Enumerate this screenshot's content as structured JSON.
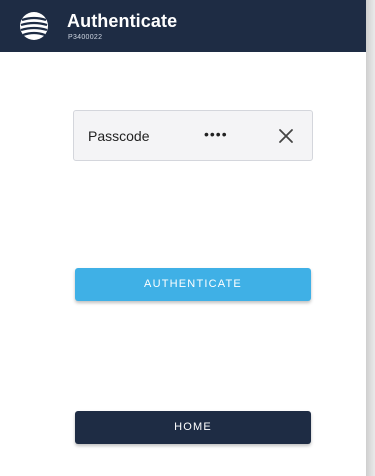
{
  "header": {
    "title": "Authenticate",
    "subtitle": "P3400022",
    "logo_icon": "globe-logo-icon"
  },
  "form": {
    "passcode_label": "Passcode",
    "passcode_value": "••••",
    "clear_icon": "close-icon"
  },
  "buttons": {
    "authenticate_label": "AUTHENTICATE",
    "home_label": "HOME"
  },
  "colors": {
    "header_bg": "#1e2c44",
    "authenticate_bg": "#3fb0e6",
    "home_bg": "#1e2c44"
  }
}
